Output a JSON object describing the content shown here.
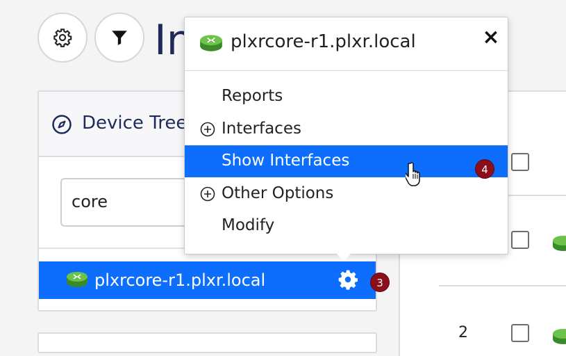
{
  "toolbar": {
    "settings_icon": "gear-icon",
    "filter_icon": "filter-icon"
  },
  "page": {
    "title": "In"
  },
  "device_tree": {
    "title": "Device Tree",
    "title_icon": "compass-icon",
    "search": {
      "value": "core",
      "placeholder": ""
    },
    "items": [
      {
        "label": "plxrcore-r1.plxr.local",
        "icon": "router-icon",
        "selected": true
      }
    ]
  },
  "badges": {
    "gear_step": "3",
    "menu_step": "4"
  },
  "popover": {
    "title": "plxrcore-r1.plxr.local",
    "close_label": "×",
    "menu": [
      {
        "label": "Reports",
        "expandable": false,
        "active": false
      },
      {
        "label": "Interfaces",
        "expandable": true,
        "active": false
      },
      {
        "label": "Show Interfaces",
        "expandable": false,
        "active": true
      },
      {
        "label": "Other Options",
        "expandable": true,
        "active": false
      },
      {
        "label": "Modify",
        "expandable": false,
        "active": false
      }
    ]
  },
  "right_table": {
    "rows": [
      {
        "num": ""
      },
      {
        "num": ""
      },
      {
        "num": "2"
      }
    ]
  },
  "colors": {
    "accent": "#0d6efd",
    "badge": "#8b0f1a",
    "title": "#1e2a5a"
  }
}
